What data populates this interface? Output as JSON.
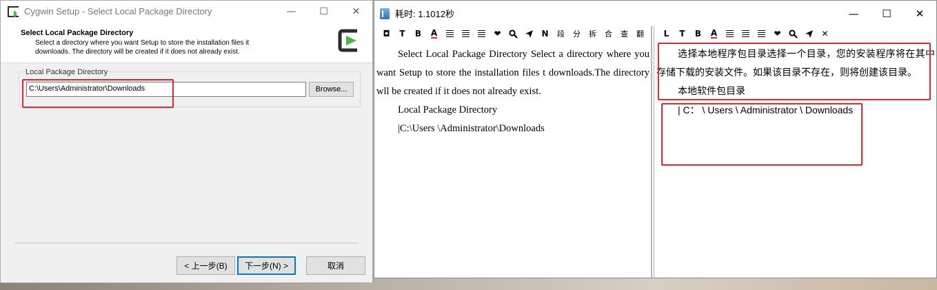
{
  "cygwin": {
    "title": "Cygwin Setup - Select Local Package Directory",
    "header_title": "Select Local Package Directory",
    "header_desc": "Select a directory where you want Setup to store the installation files it downloads.  The directory will be created if it does not already exist.",
    "group_label": "Local Package Directory",
    "path_value": "C:\\Users\\Administrator\\Downloads",
    "browse_label": "Browse...",
    "back_label": "< 上一步(B)",
    "next_label": "下一步(N) >",
    "cancel_label": "取消",
    "min_glyph": "—",
    "max_glyph": "☐",
    "close_glyph": "✕"
  },
  "translator": {
    "title": "耗时: 1.1012秒",
    "min_glyph": "—",
    "max_glyph": "☐",
    "close_glyph": "✕",
    "left_toolbar": [
      "◘",
      "T",
      "B",
      "A",
      "≡",
      "≡",
      "≡",
      "❤",
      "🔍",
      "➤",
      "N",
      "段",
      "分",
      "拆",
      "合",
      "查",
      "翻"
    ],
    "right_toolbar": [
      "L",
      "T",
      "B",
      "A",
      "≡",
      "≡",
      "≡",
      "❤",
      "🔍",
      "➤",
      "✕"
    ],
    "source_paragraph": "Select Local Package Directory Select a directory where you want Setup to store the installation files t downloads.The directory wll be created if it does not already exist.",
    "source_label": "Local Package Directory",
    "source_path": "|C:\\Users \\Administrator\\Downloads",
    "target_paragraph": "选择本地程序包目录选择一个目录，您的安装程序将在其中存储下载的安装文件。如果该目录不存在，则将创建该目录。",
    "target_label": "本地软件包目录",
    "target_path": "| C： \\ Users \\ Administrator \\ Downloads"
  },
  "colors": {
    "highlight_box": "#e8262b",
    "window_bg": "#f0f0f0",
    "focus_border": "#0078d7"
  }
}
